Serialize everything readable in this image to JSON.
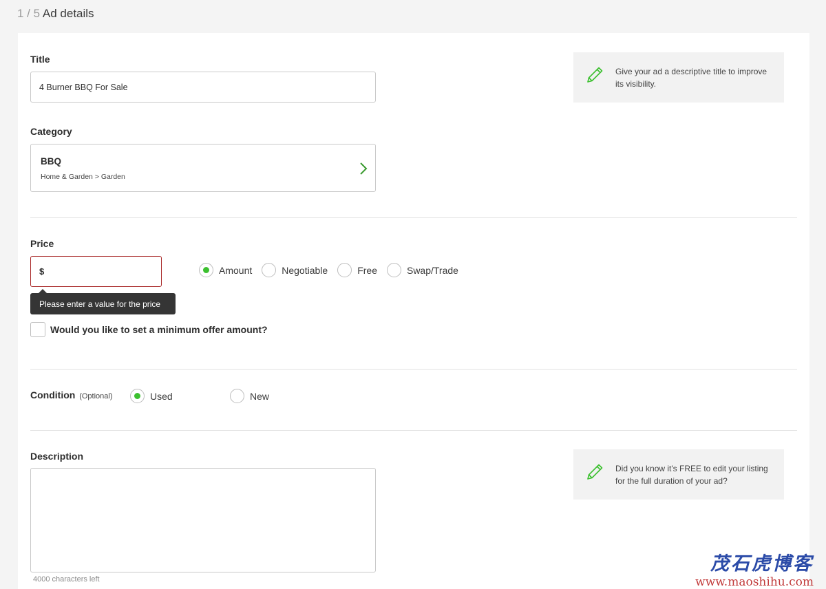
{
  "header": {
    "step_count": "1 / 5",
    "title": "Ad details"
  },
  "title_section": {
    "label": "Title",
    "value": "4 Burner BBQ For Sale"
  },
  "category_section": {
    "label": "Category",
    "name": "BBQ",
    "path": "Home & Garden > Garden"
  },
  "price_section": {
    "label": "Price",
    "value": "$",
    "error": "Please enter a value for the price",
    "options": [
      "Amount",
      "Negotiable",
      "Free",
      "Swap/Trade"
    ],
    "selected": "Amount",
    "min_offer_label": "Would you like to set a minimum offer amount?"
  },
  "condition_section": {
    "label": "Condition",
    "optional": "(Optional)",
    "options": [
      "Used",
      "New"
    ],
    "selected": "Used"
  },
  "description_section": {
    "label": "Description",
    "value": "",
    "counter": "4000 characters left"
  },
  "tips": {
    "title_tip": "Give your ad a descriptive title to improve its visibility.",
    "description_tip": "Did you know it's FREE to edit your listing for the full duration of your ad?"
  },
  "watermark": {
    "cn": "茂石虎博客",
    "url": "www.maoshihu.com"
  },
  "colors": {
    "accent_green": "#3cc02f",
    "error_red": "#a82727",
    "tooltip_bg": "#353535"
  }
}
